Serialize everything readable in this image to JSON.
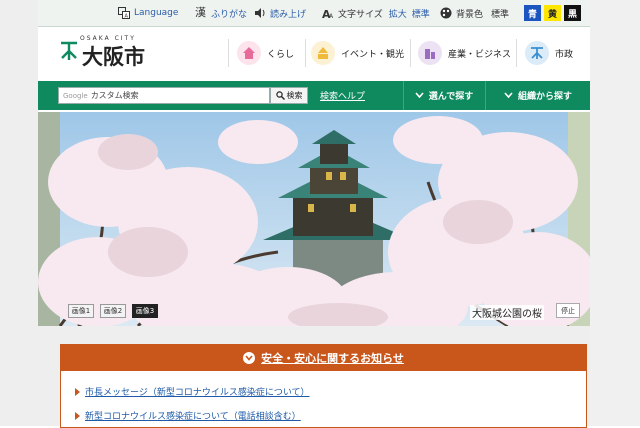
{
  "topbar": {
    "language": "Language",
    "furigana": "ふりがな",
    "read_aloud": "読み上げ",
    "text_size": "文字サイズ",
    "enlarge": "拡大",
    "standard": "標準",
    "bg_color": "背景色",
    "bg_standard": "標準",
    "bg_blue": "青",
    "bg_yellow": "黄",
    "bg_black": "黒"
  },
  "header": {
    "logo_sub": "OSAKA CITY",
    "logo_name": "大阪市",
    "nav": [
      {
        "label": "くらし",
        "icon": "house-icon",
        "color": "#e86a9a"
      },
      {
        "label": "イベント・観光",
        "icon": "event-icon",
        "color": "#f0b93a"
      },
      {
        "label": "産業・ビジネス",
        "icon": "building-icon",
        "color": "#9b6cc0"
      },
      {
        "label": "市政",
        "icon": "city-emblem-icon",
        "color": "#3a8fd0"
      }
    ]
  },
  "search": {
    "google_label": "Google",
    "placeholder": "カスタム検索",
    "button": "検索",
    "help": "検索ヘルプ",
    "choose": "選んで探す",
    "by_org": "組織から探す"
  },
  "hero": {
    "slides": [
      "画像1",
      "画像2",
      "画像3"
    ],
    "active_slide": 3,
    "caption": "大阪城公園の桜",
    "stop": "停止"
  },
  "alert": {
    "title": "安全・安心に関するお知らせ",
    "items": [
      "市長メッセージ（新型コロナウイルス感染症について）",
      "新型コロナウイルス感染症について（電話相談含む）"
    ]
  },
  "colors": {
    "green": "#0f8a5f",
    "alert": "#c9561a",
    "link": "#1e5aa8"
  }
}
